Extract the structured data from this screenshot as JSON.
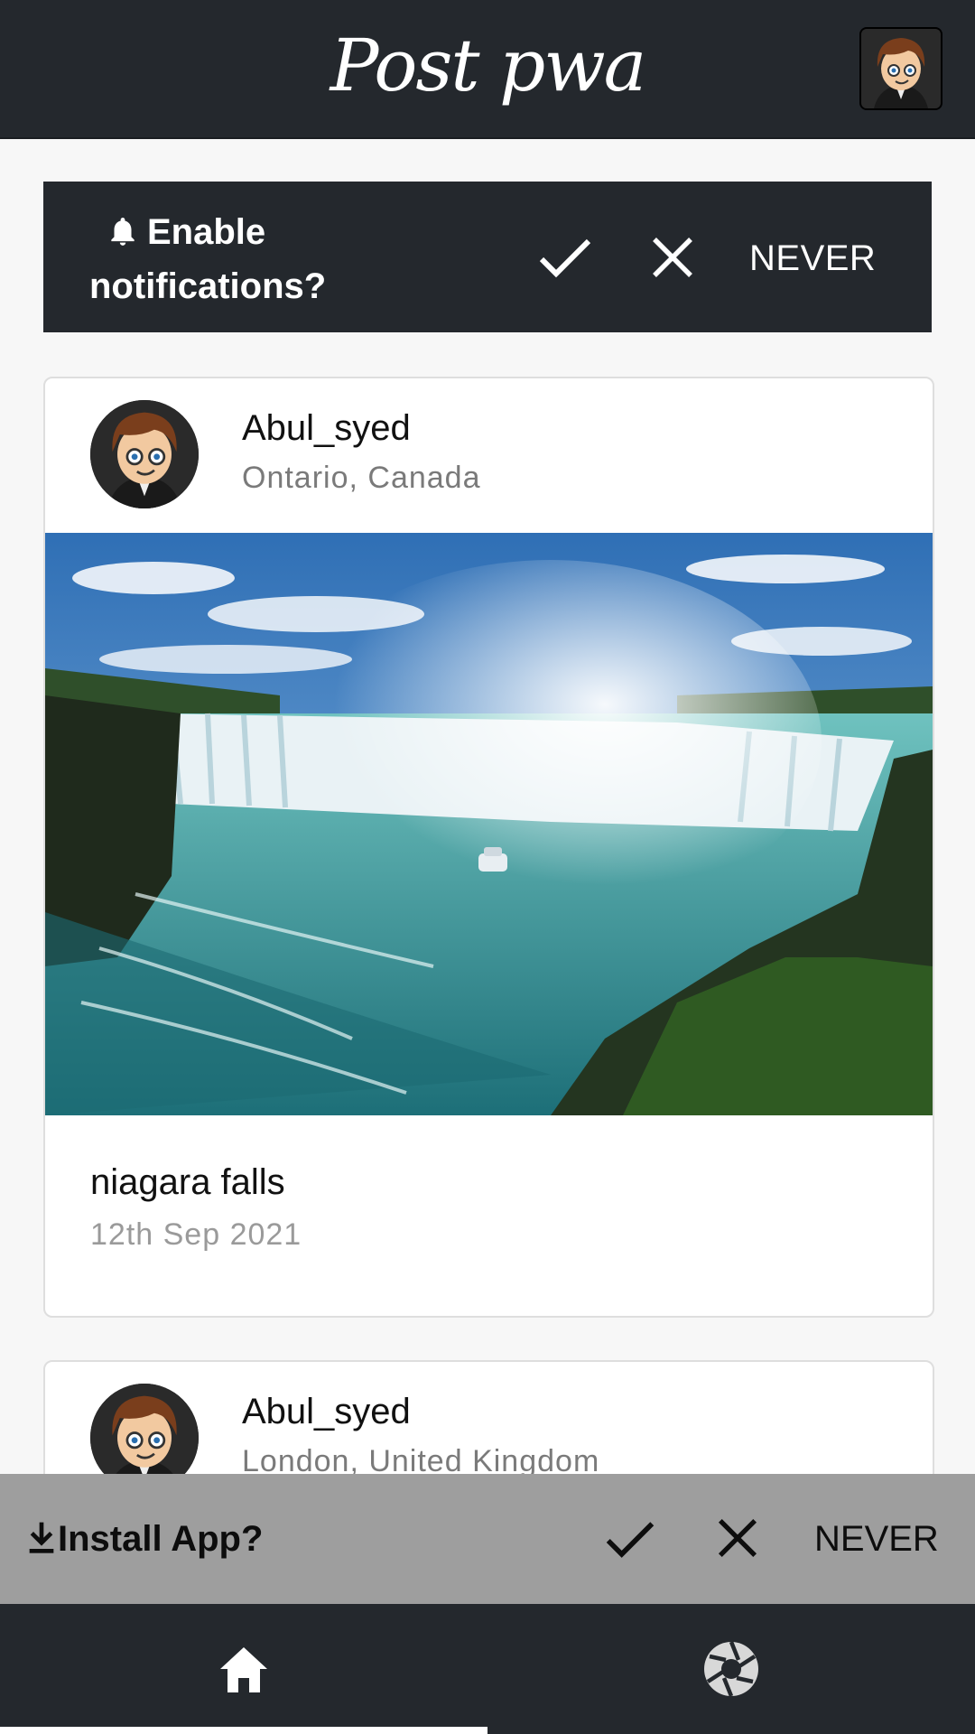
{
  "app": {
    "title": "Post pwa"
  },
  "notification_prompt": {
    "text": "Enable notifications?",
    "never_label": "NEVER"
  },
  "posts": [
    {
      "username": "Abul_syed",
      "location": "Ontario, Canada",
      "caption": "niagara falls",
      "date": "12th Sep 2021"
    },
    {
      "username": "Abul_syed",
      "location": "London, United Kingdom"
    }
  ],
  "install_prompt": {
    "text": "Install App?",
    "never_label": "NEVER"
  },
  "bottom_nav": {
    "items": [
      {
        "icon": "home-icon",
        "active": true
      },
      {
        "icon": "camera-icon",
        "active": false
      }
    ]
  },
  "colors": {
    "dark": "#24282d",
    "install_bg": "#9e9e9e",
    "page_bg": "#f7f7f7"
  }
}
